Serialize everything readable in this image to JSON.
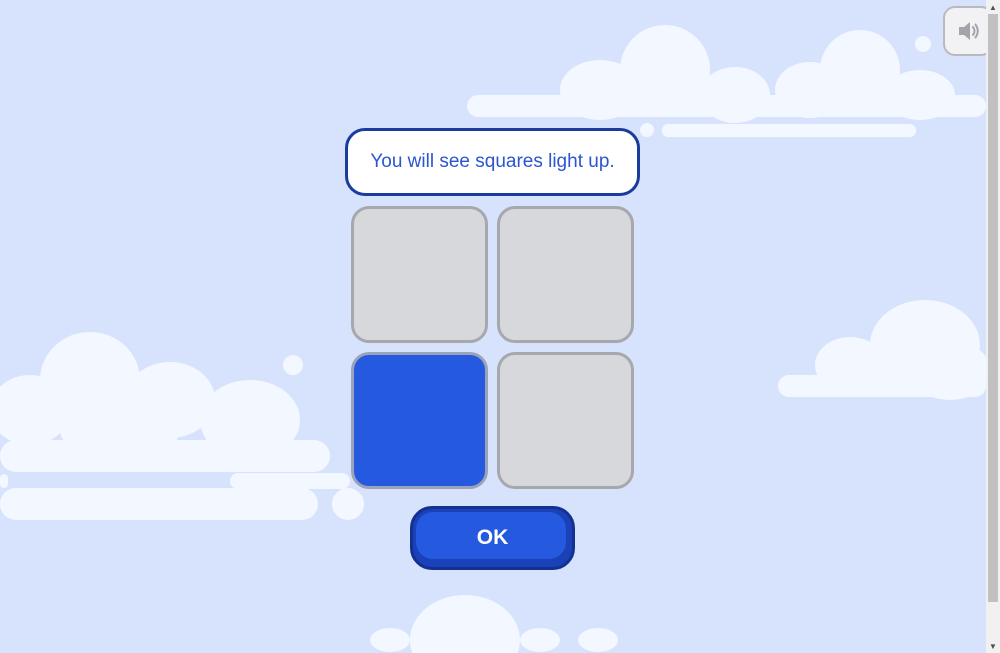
{
  "instruction": {
    "text": "You will see squares light up."
  },
  "grid": {
    "tiles": [
      {
        "lit": false
      },
      {
        "lit": false
      },
      {
        "lit": true
      },
      {
        "lit": false
      }
    ],
    "lit_color": "#255ae0",
    "unlit_color": "#d7d8db"
  },
  "ok_button": {
    "label": "OK"
  },
  "sound_button": {
    "icon": "speaker-icon"
  },
  "colors": {
    "sky": "#d7e3fc",
    "cloud": "#f3f7ff",
    "accent": "#255ae0",
    "border_dark": "#1a3c9c"
  },
  "scrollbar": {
    "up_glyph": "▲",
    "down_glyph": "▼"
  }
}
